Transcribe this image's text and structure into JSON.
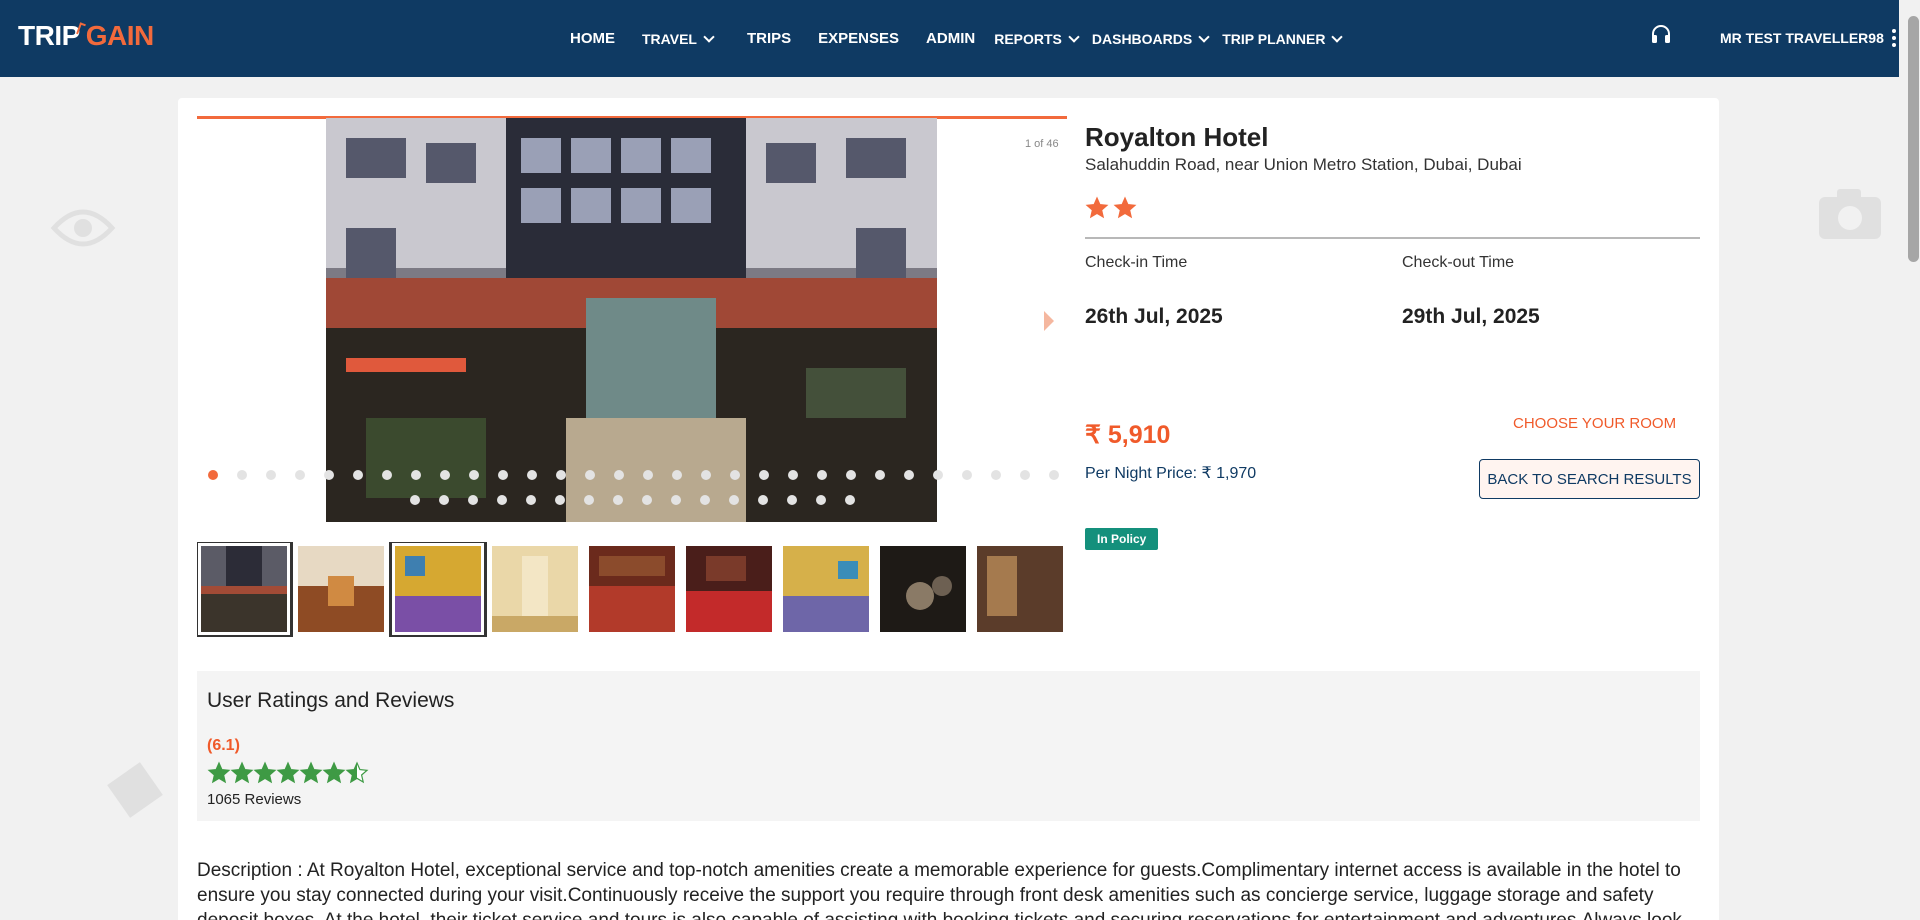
{
  "brand": {
    "logo_left": "TRIP",
    "logo_right": "GAIN"
  },
  "nav": {
    "items": [
      {
        "label": "HOME",
        "dropdown": false
      },
      {
        "label": "TRAVEL",
        "dropdown": true
      },
      {
        "label": "TRIPS",
        "dropdown": false
      },
      {
        "label": "EXPENSES",
        "dropdown": false
      },
      {
        "label": "ADMIN",
        "dropdown": false
      },
      {
        "label": "REPORTS",
        "dropdown": true
      },
      {
        "label": "DASHBOARDS",
        "dropdown": true
      },
      {
        "label": "TRIP PLANNER",
        "dropdown": true
      }
    ],
    "user": "MR TEST TRAVELLER98",
    "support_icon": "headset-icon",
    "menu_icon": "kebab-menu-icon"
  },
  "gallery": {
    "counter": "1 of 46",
    "current_index": 1,
    "total_photos": 46,
    "thumbnail_count_visible": 9
  },
  "hotel": {
    "name": "Royalton Hotel",
    "address": "Salahuddin Road, near Union Metro Station, Dubai, Dubai",
    "star_rating": 2,
    "checkin_label": "Check-in Time",
    "checkin_date": "26th Jul, 2025",
    "checkout_label": "Check-out Time",
    "checkout_date": "29th Jul, 2025",
    "price": "₹ 5,910",
    "per_night": "Per Night Price: ₹ 1,970",
    "choose_room": "CHOOSE YOUR ROOM",
    "back_button": "BACK TO SEARCH RESULTS",
    "policy_badge": "In Policy"
  },
  "reviews": {
    "title": "User Ratings and Reviews",
    "score": "(6.1)",
    "stars_out_of_7": 6.5,
    "count": "1065 Reviews"
  },
  "description": "Description : At Royalton Hotel, exceptional service and top-notch amenities create a memorable experience for guests.Complimentary internet access is available in the hotel to ensure you stay connected during your visit.Continuously receive the support you require through front desk amenities such as concierge service, luggage storage and safety deposit boxes. At the hotel, their ticket service and tours is also capable of assisting with booking tickets and securing reservations for entertainment and adventures.Always look",
  "colors": {
    "header": "#0f3a63",
    "accent": "#f26a3c",
    "policy": "#14907c",
    "review_star": "#3e9a44"
  }
}
